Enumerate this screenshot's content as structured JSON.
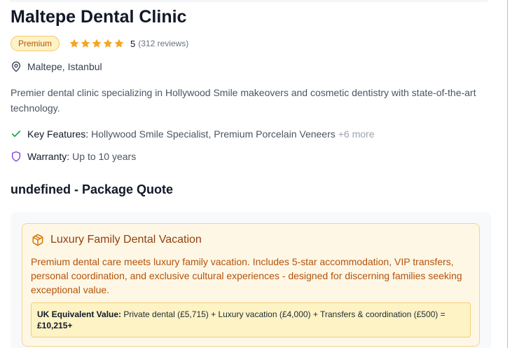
{
  "clinic": {
    "name": "Maltepe Dental Clinic",
    "badge": "Premium",
    "rating": "5",
    "reviews": "(312 reviews)",
    "location": "Maltepe, Istanbul",
    "description": "Premier dental clinic specializing in Hollywood Smile makeovers and cosmetic dentistry with state-of-the-art technology."
  },
  "features": {
    "key_label": "Key Features:",
    "key_value": "Hollywood Smile Specialist, Premium Porcelain Veneers",
    "key_more": "+6 more",
    "warranty_label": "Warranty:",
    "warranty_value": "Up to 10 years"
  },
  "quote": {
    "section_title": "undefined - Package Quote",
    "package_title": "Luxury Family Dental Vacation",
    "package_description": "Premium dental care meets luxury family vacation. Includes 5-star accommodation, VIP transfers, personal coordination, and exclusive cultural experiences - designed for discerning families seeking exceptional value.",
    "uk_label": "UK Equivalent Value:",
    "uk_breakdown": "Private dental (£5,715) + Luxury vacation (£4,000) + Transfers & coordination (£500) =",
    "uk_total": "£10,215+"
  },
  "icons": {
    "star": "star-icon",
    "location": "map-pin-icon",
    "check": "check-icon",
    "warranty": "shield-icon",
    "package": "package-box-icon"
  },
  "colors": {
    "star": "#f5a524",
    "check": "#16a34a",
    "shield": "#7c3aed",
    "badge_text": "#b45309",
    "package_accent": "#d97706"
  }
}
